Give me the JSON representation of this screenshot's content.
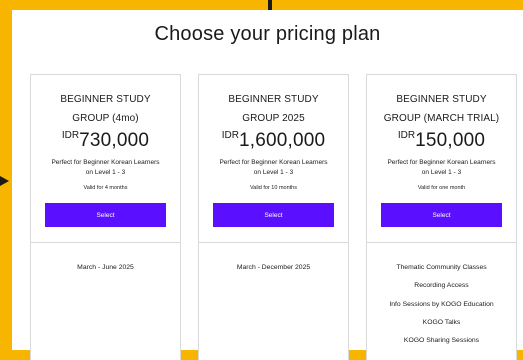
{
  "page": {
    "heading": "Choose your pricing plan",
    "accent_color": "#5b0fff",
    "background_color": "#f7b500"
  },
  "plans": [
    {
      "title_line1": "BEGINNER STUDY",
      "title_line2": "GROUP (4mo)",
      "currency": "IDR",
      "price": "730,000",
      "desc_line1": "Perfect for Beginner Korean Learners",
      "desc_line2": "on Level 1 - 3",
      "validity": "Valid for 4 months",
      "button_label": "Select",
      "features": [
        "March - June 2025"
      ]
    },
    {
      "title_line1": "BEGINNER STUDY",
      "title_line2": "GROUP 2025",
      "currency": "IDR",
      "price": "1,600,000",
      "desc_line1": "Perfect for Beginner Korean Learners",
      "desc_line2": "on Level 1 - 3",
      "validity": "Valid for 10 months",
      "button_label": "Select",
      "features": [
        "March - December 2025"
      ]
    },
    {
      "title_line1": "BEGINNER STUDY",
      "title_line2": "GROUP (MARCH TRIAL)",
      "currency": "IDR",
      "price": "150,000",
      "desc_line1": "Perfect for Beginner Korean Learners",
      "desc_line2": "on Level 1 - 3",
      "validity": "Valid for one month",
      "button_label": "Select",
      "features": [
        "Thematic Community Classes",
        "Recording Access",
        "Info Sessions by KOGO Education",
        "KOGO Talks",
        "KOGO Sharing Sessions"
      ]
    }
  ]
}
